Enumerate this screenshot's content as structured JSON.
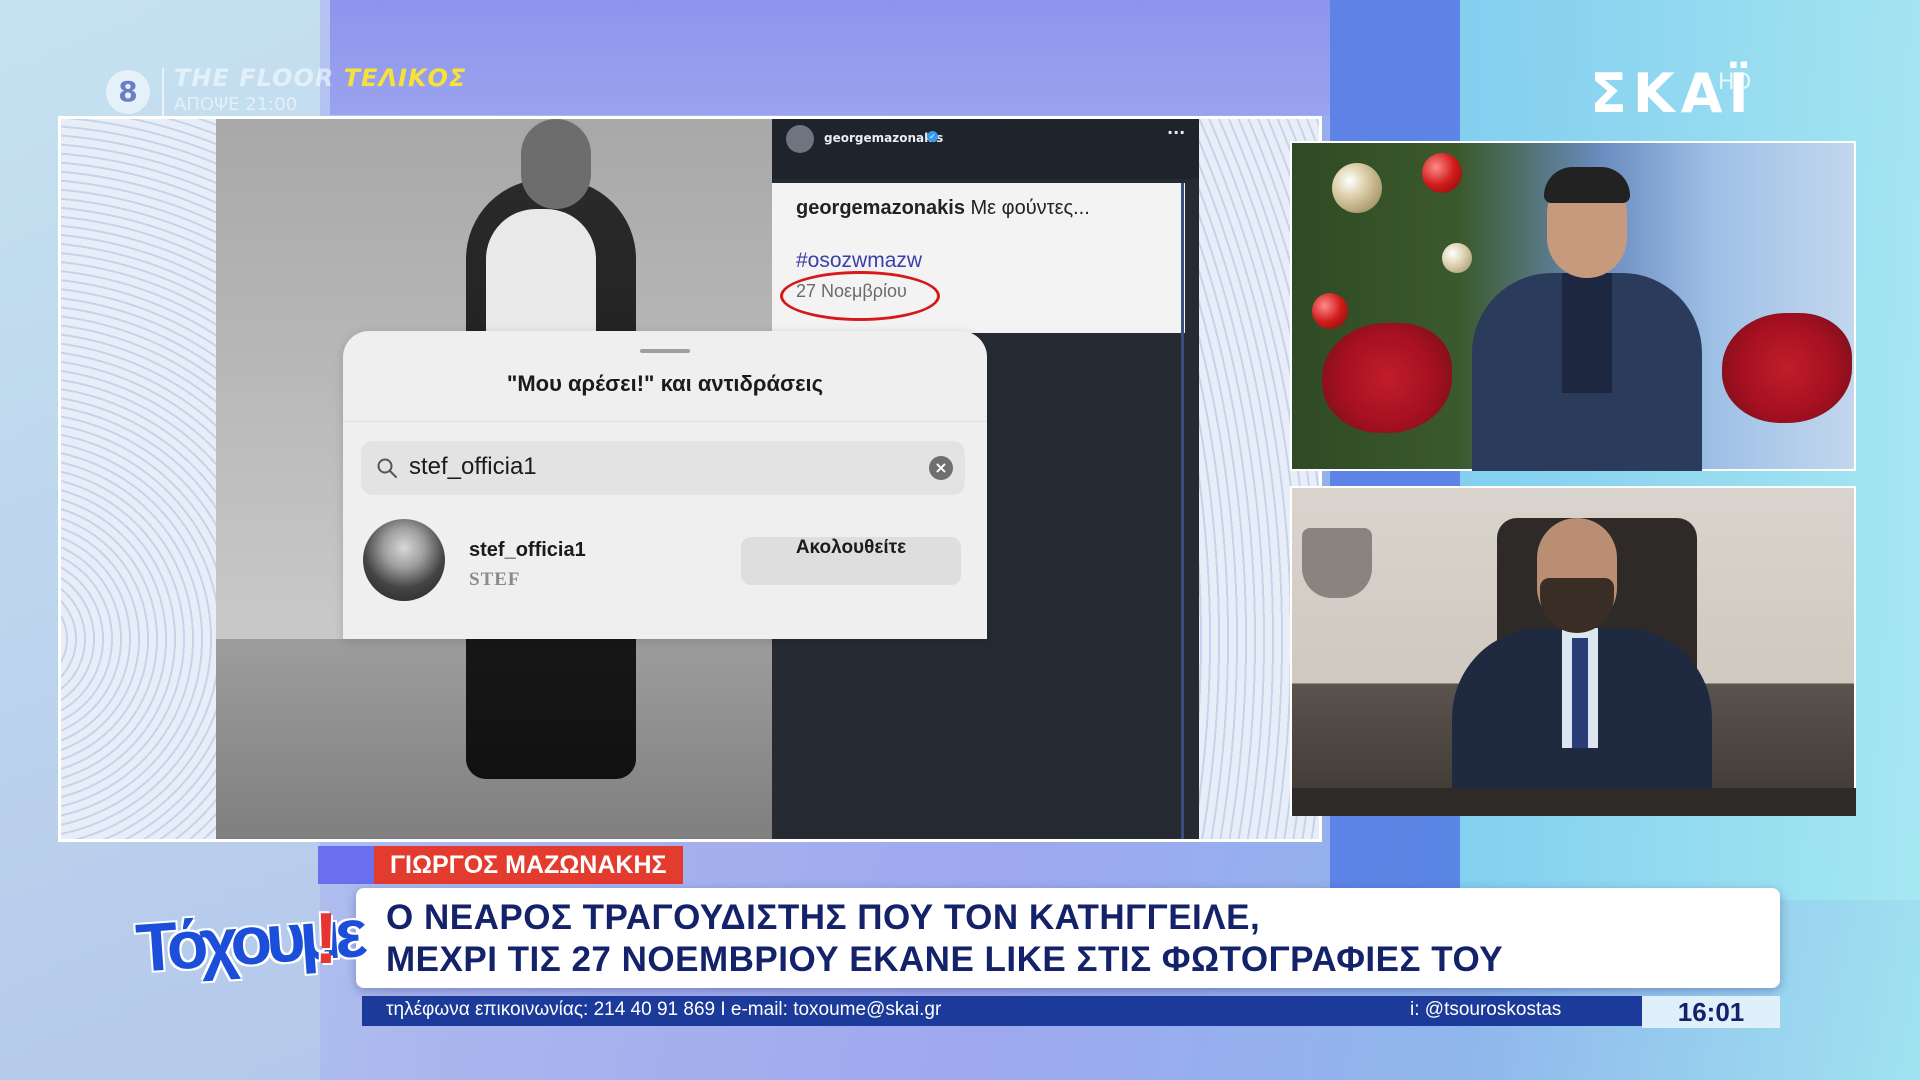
{
  "channel": {
    "number": "8",
    "promo_title_part1": "THE FLOOR",
    "promo_title_part2": "ΤΕΛΙΚΟΣ",
    "promo_time": "ΑΠΟΨΕ 21:00",
    "logo": "ΣΚΑΪ",
    "logo_suffix": "HD"
  },
  "instagram": {
    "username": "georgemazonakis",
    "verified_icon": "verified-badge-icon",
    "caption_user": "georgemazonakis",
    "caption_text": " Με φούντες...",
    "hashtag": "#osozwmazw",
    "date": "27 Νοεμβρίου",
    "likes_sheet": {
      "title": "\"Μου αρέσει!\" και αντιδράσεις",
      "search_value": "stef_officia1",
      "result_username": "stef_officia1",
      "result_fullname": "STEF",
      "follow_label": "Ακολουθείτε"
    }
  },
  "lower_third": {
    "name_strap": "ΓΙΩΡΓΟΣ ΜΑΖΩΝΑΚΗΣ",
    "headline_line1": "Ο ΝΕΑΡΟΣ ΤΡΑΓΟΥΔΙΣΤΗΣ ΠΟΥ ΤΟΝ ΚΑΤΗΓΓΕΙΛΕ,",
    "headline_line2": "ΜΕΧΡΙ ΤΙΣ 27 ΝΟΕΜΒΡΙΟΥ ΕΚΑΝΕ LIKE ΣΤΙΣ ΦΩΤΟΓΡΑΦΙΕΣ ΤΟΥ",
    "show_logo": "Τόχουμε",
    "show_logo_excl": "!",
    "ticker_contact": "τηλέφωνα επικοινωνίας: 214 40 91 869  I  e-mail: toxoume@skai.gr",
    "ticker_handle": "i: @tsouroskostas",
    "clock": "16:01"
  },
  "colors": {
    "accent_blue": "#1c3a9a",
    "strap_red": "#e43b2f",
    "headline_navy": "#14226a",
    "circle_red": "#d61a1a"
  }
}
